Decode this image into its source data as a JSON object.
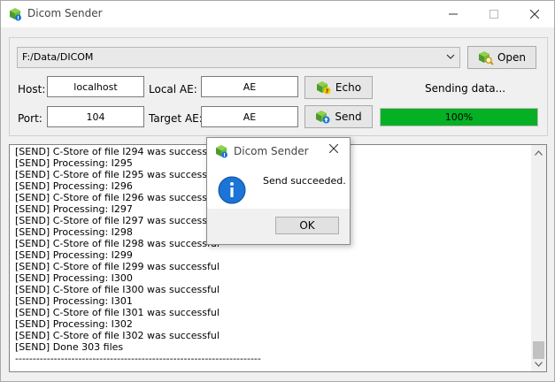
{
  "window": {
    "title": "Dicom Sender"
  },
  "controls": {
    "path_value": "F:/Data/DICOM",
    "open_label": "Open",
    "echo_label": "Echo",
    "send_label": "Send",
    "host_label": "Host:",
    "host_value": "localhost",
    "port_label": "Port:",
    "port_value": "104",
    "local_ae_label": "Local AE:",
    "local_ae_value": "AE",
    "target_ae_label": "Target AE:",
    "target_ae_value": "AE",
    "status_text": "Sending data...",
    "progress_label": "100%",
    "progress_fraction": 1.0,
    "progress_color": "#06b025"
  },
  "log": {
    "lines": [
      "[SEND] C-Store of file I294 was successful",
      "[SEND] Processing: I295",
      "[SEND] C-Store of file I295 was successful",
      "[SEND] Processing: I296",
      "[SEND] C-Store of file I296 was successful",
      "[SEND] Processing: I297",
      "[SEND] C-Store of file I297 was successful",
      "[SEND] Processing: I298",
      "[SEND] C-Store of file I298 was successful",
      "[SEND] Processing: I299",
      "[SEND] C-Store of file I299 was successful",
      "[SEND] Processing: I300",
      "[SEND] C-Store of file I300 was successful",
      "[SEND] Processing: I301",
      "[SEND] C-Store of file I301 was successful",
      "[SEND] Processing: I302",
      "[SEND] C-Store of file I302 was successful",
      "[SEND] Done 303 files",
      "----------------------------------------------------------------------"
    ]
  },
  "dialog": {
    "title": "Dicom Sender",
    "message": "Send succeeded.",
    "ok_label": "OK",
    "icon": "info-icon"
  },
  "colors": {
    "accent": "#0078d7",
    "progress": "#06b025"
  }
}
